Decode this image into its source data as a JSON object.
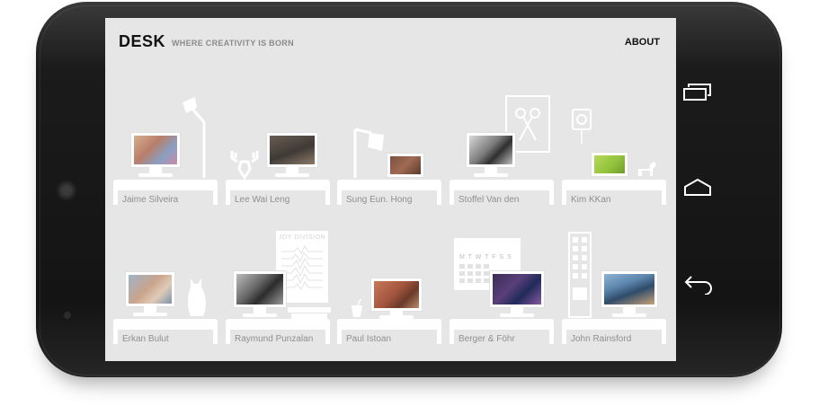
{
  "header": {
    "brand": "DESK",
    "tagline": "WHERE CREATIVITY IS BORN",
    "about": "ABOUT"
  },
  "desks": [
    {
      "name": "Jaime Silveira"
    },
    {
      "name": "Lee Wai Leng"
    },
    {
      "name": "Sung Eun. Hong"
    },
    {
      "name": "Stoffel Van den"
    },
    {
      "name": "Kim KKan"
    },
    {
      "name": "Erkan Bulut"
    },
    {
      "name": "Raymund Punzalan"
    },
    {
      "name": "Paul Istoan"
    },
    {
      "name": "Berger & Föhr"
    },
    {
      "name": "John Rainsford"
    }
  ],
  "decor": {
    "poster": "JOY DIVISION",
    "calendar_days": "M T W T F S S"
  },
  "navbar": {
    "recent_apps": "recent-apps-icon",
    "home": "home-icon",
    "back": "back-icon"
  },
  "colors": {
    "screen_bg": "#e6e6e6",
    "desk": "#ffffff",
    "name_text": "#8f8f8f",
    "phone_body": "#1b1b1b"
  }
}
